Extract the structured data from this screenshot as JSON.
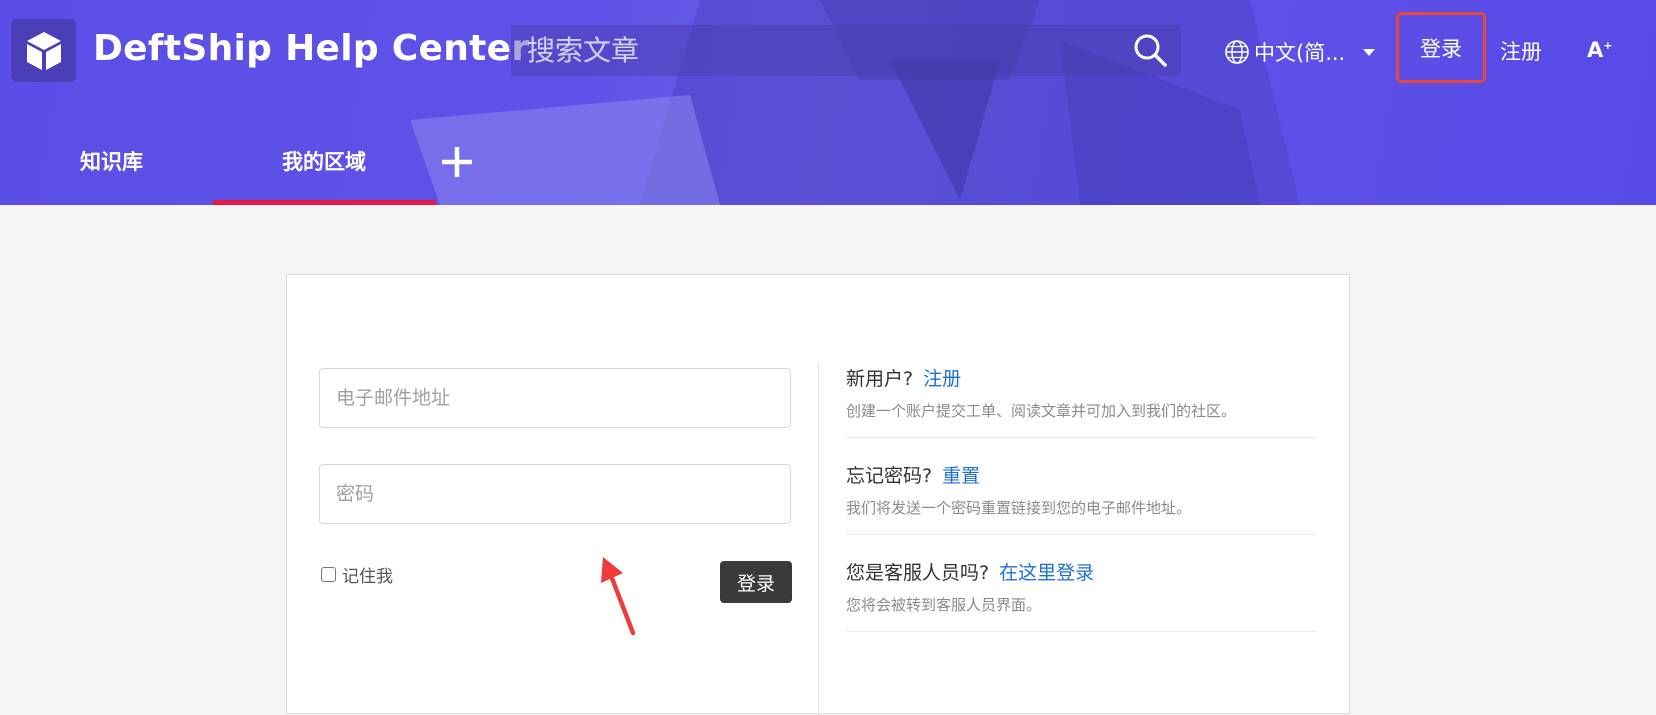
{
  "header": {
    "site_title": "DeftShip Help Center",
    "search_placeholder": "搜索文章",
    "language": "中文(简...",
    "login_label": "登录",
    "register_label": "注册",
    "a11y_label": "A",
    "a11y_sup": "+"
  },
  "tabs": [
    {
      "label": "知识库"
    },
    {
      "label": "我的区域",
      "active": true
    }
  ],
  "login_form": {
    "email_placeholder": "电子邮件地址",
    "password_placeholder": "密码",
    "remember_label": "记住我",
    "submit_label": "登录"
  },
  "info": [
    {
      "title": "新用户?",
      "link": "注册",
      "desc": "创建一个账户提交工单、阅读文章并可加入到我们的社区。"
    },
    {
      "title": "忘记密码?",
      "link": "重置",
      "desc": "我们将发送一个密码重置链接到您的电子邮件地址。"
    },
    {
      "title": "您是客服人员吗?",
      "link": "在这里登录",
      "desc": "您将会被转到客服人员界面。"
    }
  ],
  "colors": {
    "header": "#5b4ee6",
    "highlight": "#e8473e",
    "tab_underline": "#e5194a",
    "link": "#1e6fd9",
    "button": "#3a3a3a"
  },
  "icons": [
    "cube-logo-icon",
    "search-icon",
    "globe-icon",
    "plus-icon",
    "arrow-annotation-icon"
  ]
}
